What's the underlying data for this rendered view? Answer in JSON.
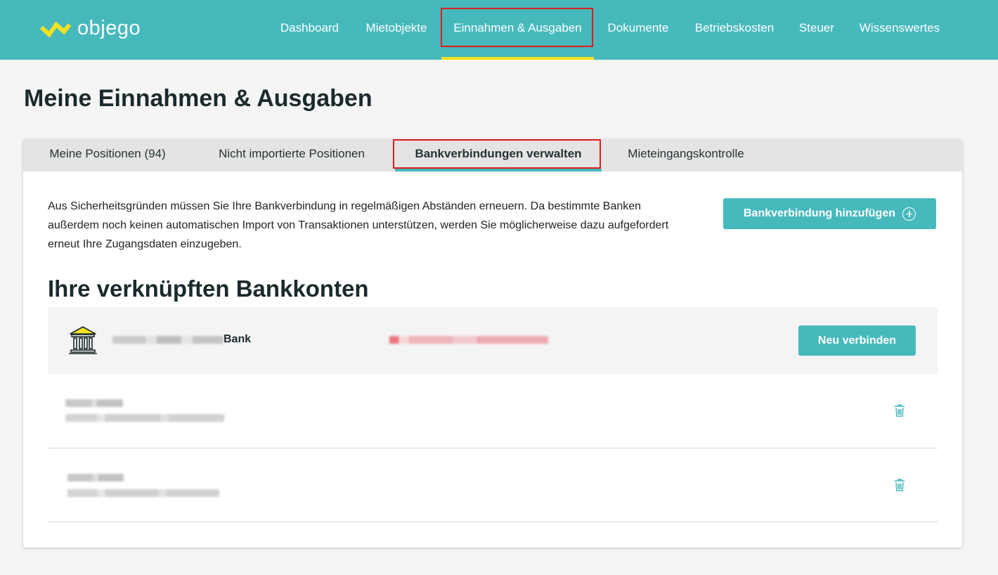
{
  "header": {
    "logo_text": "objego",
    "nav": [
      {
        "label": "Dashboard"
      },
      {
        "label": "Mietobjekte"
      },
      {
        "label": "Einnahmen & Ausgaben",
        "active": true
      },
      {
        "label": "Dokumente"
      },
      {
        "label": "Betriebskosten"
      },
      {
        "label": "Steuer"
      },
      {
        "label": "Wissenswertes"
      }
    ]
  },
  "page": {
    "title": "Meine Einnahmen & Ausgaben"
  },
  "tabs": [
    {
      "label": "Meine Positionen (94)"
    },
    {
      "label": "Nicht importierte Positionen"
    },
    {
      "label": "Bankverbindungen verwalten",
      "active": true
    },
    {
      "label": "Mieteingangskontrolle"
    }
  ],
  "content": {
    "info_text": "Aus Sicherheitsgründen müssen Sie Ihre Bankverbindung in regelmäßigen Abständen erneuern. Da bestimmte Banken außerdem noch keinen automatischen Import von Transaktionen unterstützen, werden Sie möglicherweise dazu aufgefordert erneut Ihre Zugangsdaten einzugeben.",
    "add_button_label": "Bankverbindung hinzufügen",
    "section_title": "Ihre verknüpften Bankkonten",
    "bank": {
      "name_suffix": "Bank",
      "reconnect_label": "Neu verbinden"
    }
  },
  "colors": {
    "brand": "#46b9bd",
    "accent_underline": "#f3e21f",
    "annotation_box": "#e01b1b"
  },
  "icons": [
    "objego-logo-icon",
    "bank-building-icon",
    "plus-circle-icon",
    "trash-icon"
  ]
}
